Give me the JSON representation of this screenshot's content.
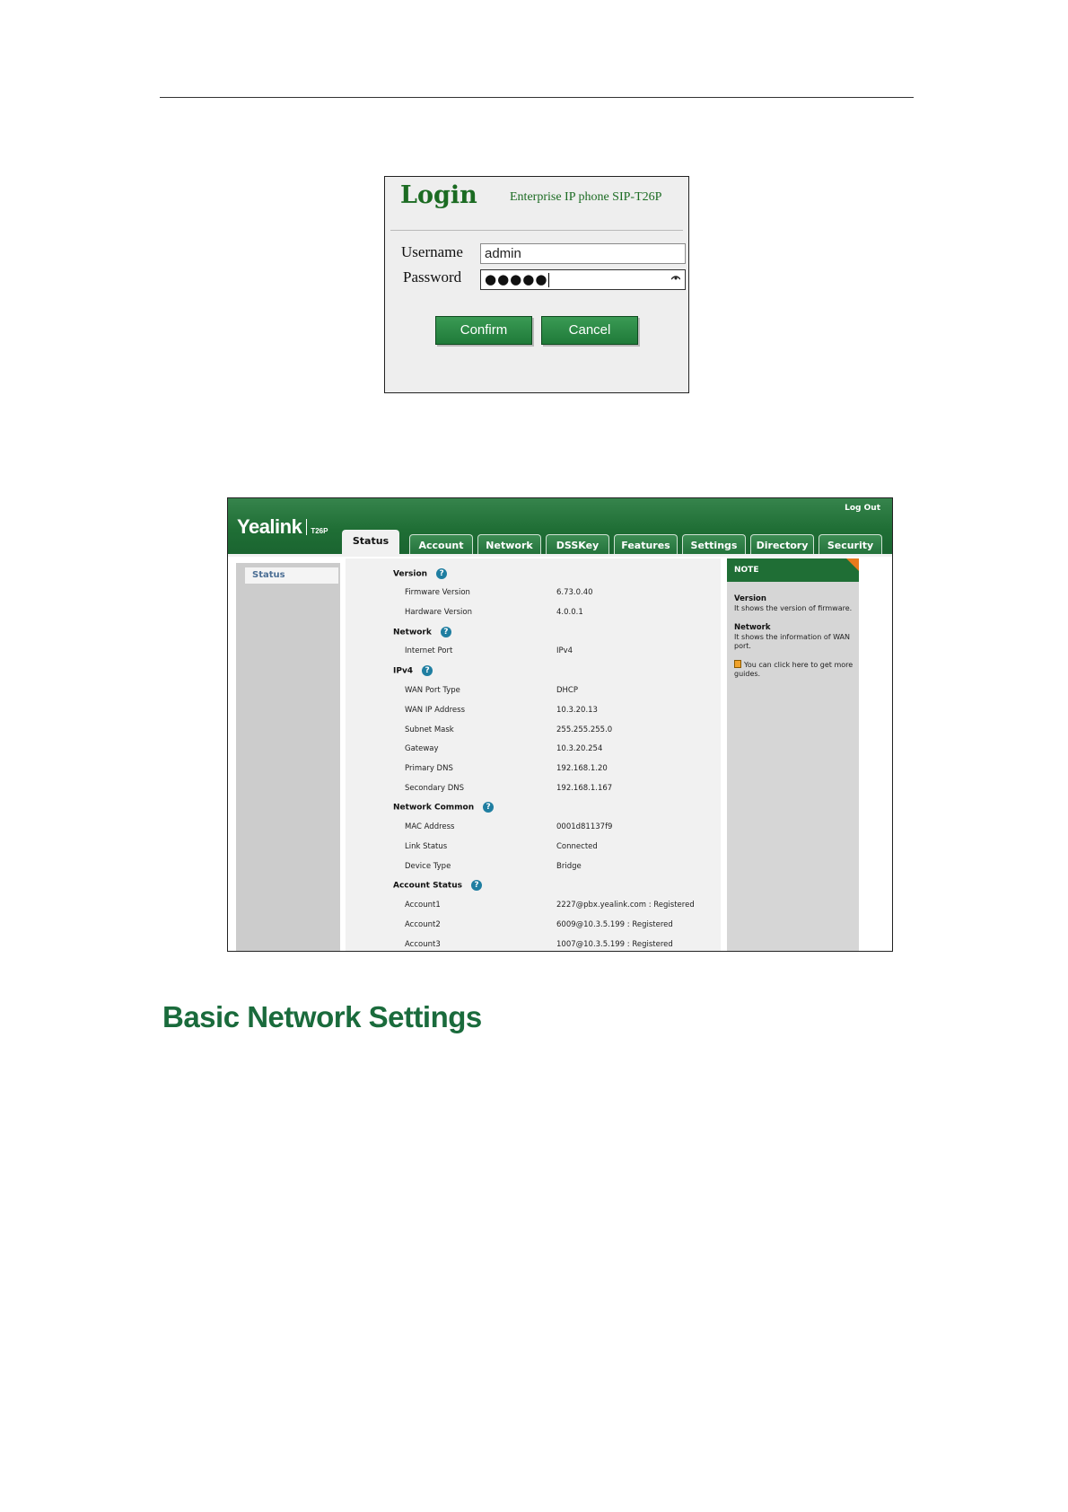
{
  "login": {
    "title": "Login",
    "subtitle": "Enterprise IP phone SIP-T26P",
    "username_label": "Username",
    "username_value": "admin",
    "password_label": "Password",
    "password_mask": "●●●●●",
    "confirm_label": "Confirm",
    "cancel_label": "Cancel"
  },
  "web": {
    "logo": "Yealink",
    "model": "T26P",
    "logout": "Log Out",
    "tabs": [
      "Status",
      "Account",
      "Network",
      "DSSKey",
      "Features",
      "Settings",
      "Directory",
      "Security"
    ],
    "active_tab": "Status",
    "sidebar": [
      "Status"
    ],
    "help_glyph": "?",
    "sections": [
      {
        "title": "Version",
        "rows": [
          [
            "Firmware Version",
            "6.73.0.40"
          ],
          [
            "Hardware Version",
            "4.0.0.1"
          ]
        ]
      },
      {
        "title": "Network",
        "rows": [
          [
            "Internet Port",
            "IPv4"
          ]
        ]
      },
      {
        "title": "IPv4",
        "rows": [
          [
            "WAN Port Type",
            "DHCP"
          ],
          [
            "WAN IP Address",
            "10.3.20.13"
          ],
          [
            "Subnet Mask",
            "255.255.255.0"
          ],
          [
            "Gateway",
            "10.3.20.254"
          ],
          [
            "Primary DNS",
            "192.168.1.20"
          ],
          [
            "Secondary DNS",
            "192.168.1.167"
          ]
        ]
      },
      {
        "title": "Network Common",
        "rows": [
          [
            "MAC Address",
            "0001d81137f9"
          ],
          [
            "Link Status",
            "Connected"
          ],
          [
            "Device Type",
            "Bridge"
          ]
        ]
      },
      {
        "title": "Account Status",
        "rows": [
          [
            "Account1",
            "2227@pbx.yealink.com : Registered"
          ],
          [
            "Account2",
            "6009@10.3.5.199 : Registered"
          ],
          [
            "Account3",
            "1007@10.3.5.199 : Registered"
          ]
        ]
      }
    ],
    "note": {
      "header": "NOTE",
      "items": [
        {
          "title": "Version",
          "text": "It shows the version of firmware."
        },
        {
          "title": "Network",
          "text": "It shows the information of WAN port."
        }
      ],
      "guide_text": "You can click here to get more guides."
    },
    "colors": {
      "brand_green": "#1f6e35",
      "help_blue": "#1f7ea1",
      "note_accent": "#e87a1c"
    }
  },
  "page": {
    "section_heading": "Basic Network Settings"
  }
}
